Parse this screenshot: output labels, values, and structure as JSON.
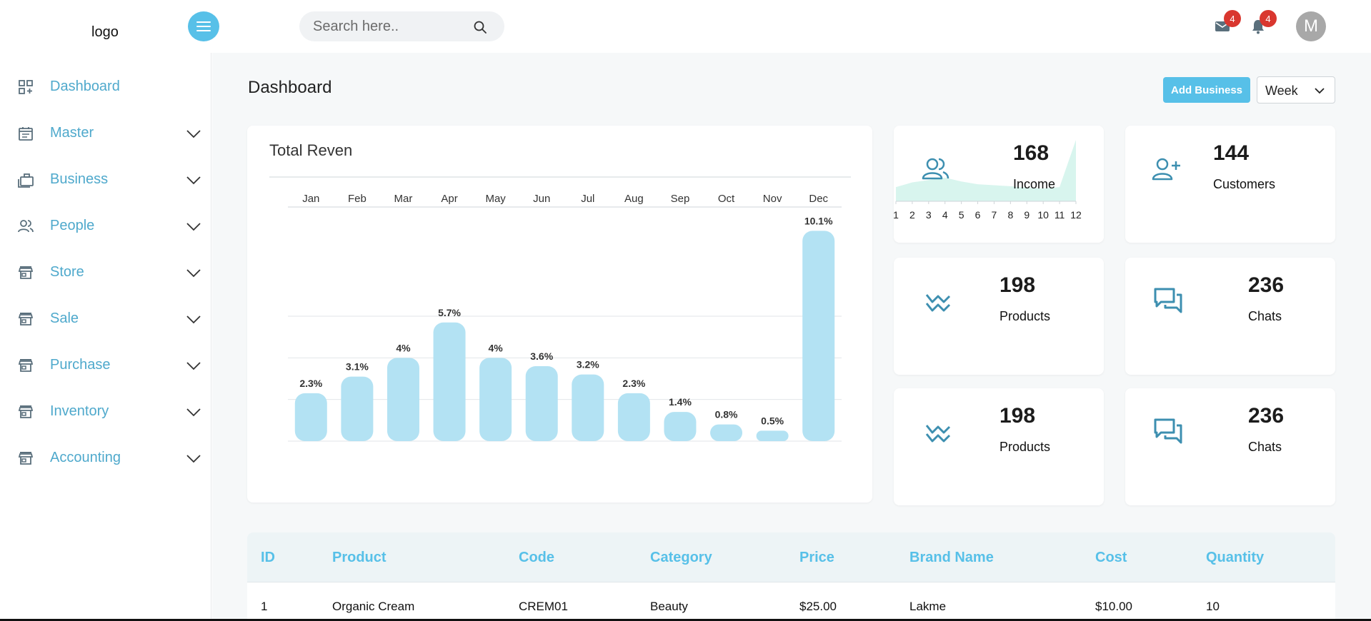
{
  "header": {
    "logo_text": "logo",
    "search_placeholder": "Search here..",
    "mail_count": "4",
    "notification_count": "4",
    "avatar_initial": "M"
  },
  "sidebar": {
    "items": [
      {
        "label": "Dashboard",
        "icon": "dashboard-icon",
        "has_submenu": false
      },
      {
        "label": "Master",
        "icon": "calendar-icon",
        "has_submenu": true
      },
      {
        "label": "Business",
        "icon": "briefcase-icon",
        "has_submenu": true
      },
      {
        "label": "People",
        "icon": "people-icon",
        "has_submenu": true
      },
      {
        "label": "Store",
        "icon": "store-icon",
        "has_submenu": true
      },
      {
        "label": "Sale",
        "icon": "store-icon",
        "has_submenu": true
      },
      {
        "label": "Purchase",
        "icon": "store-icon",
        "has_submenu": true
      },
      {
        "label": "Inventory",
        "icon": "store-icon",
        "has_submenu": true
      },
      {
        "label": "Accounting",
        "icon": "store-icon",
        "has_submenu": true
      }
    ]
  },
  "page": {
    "title": "Dashboard",
    "add_business_label": "Add Business",
    "period_selected": "Week"
  },
  "colors": {
    "accent": "#57c0e8",
    "sidebar_text": "#4fa9cc",
    "bar_fill": "#b3e2f3",
    "badge": "#d9372f",
    "icon": "#3d8fb0",
    "sparkline_fill": "#d8f5ee"
  },
  "chart_data": [
    {
      "type": "bar",
      "title": "Total Reven",
      "categories": [
        "Jan",
        "Feb",
        "Mar",
        "Apr",
        "May",
        "Jun",
        "Jul",
        "Aug",
        "Sep",
        "Oct",
        "Nov",
        "Dec"
      ],
      "values": [
        2.3,
        3.1,
        4,
        5.7,
        4,
        3.6,
        3.2,
        2.3,
        1.4,
        0.8,
        0.5,
        10.1
      ],
      "data_labels": [
        "2.3%",
        "3.1%",
        "4%",
        "5.7%",
        "4%",
        "3.6%",
        "3.2%",
        "2.3%",
        "1.4%",
        "0.8%",
        "0.5%",
        "10.1%"
      ],
      "xlabel": "",
      "ylabel": "",
      "ylim": [
        0,
        12
      ],
      "grid": true,
      "x_axis_position": "top"
    },
    {
      "type": "area",
      "title": "",
      "x": [
        1,
        2,
        3,
        4,
        5,
        6,
        7,
        8,
        9,
        10,
        11,
        12
      ],
      "values": [
        3,
        4,
        4.5,
        5,
        4.2,
        3.6,
        3.4,
        3.2,
        2.9,
        2.7,
        3,
        13
      ],
      "xlabel": "",
      "ylabel": "",
      "grid": false
    }
  ],
  "stats": [
    {
      "value": "168",
      "label": "Income",
      "icon": "users-icon"
    },
    {
      "value": "144",
      "label": "Customers",
      "icon": "user-plus-icon"
    },
    {
      "value": "198",
      "label": "Products",
      "icon": "activity-icon"
    },
    {
      "value": "236",
      "label": "Chats",
      "icon": "chat-icon"
    },
    {
      "value": "198",
      "label": "Products",
      "icon": "activity-icon"
    },
    {
      "value": "236",
      "label": "Chats",
      "icon": "chat-icon"
    }
  ],
  "table": {
    "columns": [
      "ID",
      "Product",
      "Code",
      "Category",
      "Price",
      "Brand Name",
      "Cost",
      "Quantity"
    ],
    "rows": [
      [
        "1",
        "Organic Cream",
        "CREM01",
        "Beauty",
        "$25.00",
        "Lakme",
        "$10.00",
        "10"
      ]
    ]
  }
}
